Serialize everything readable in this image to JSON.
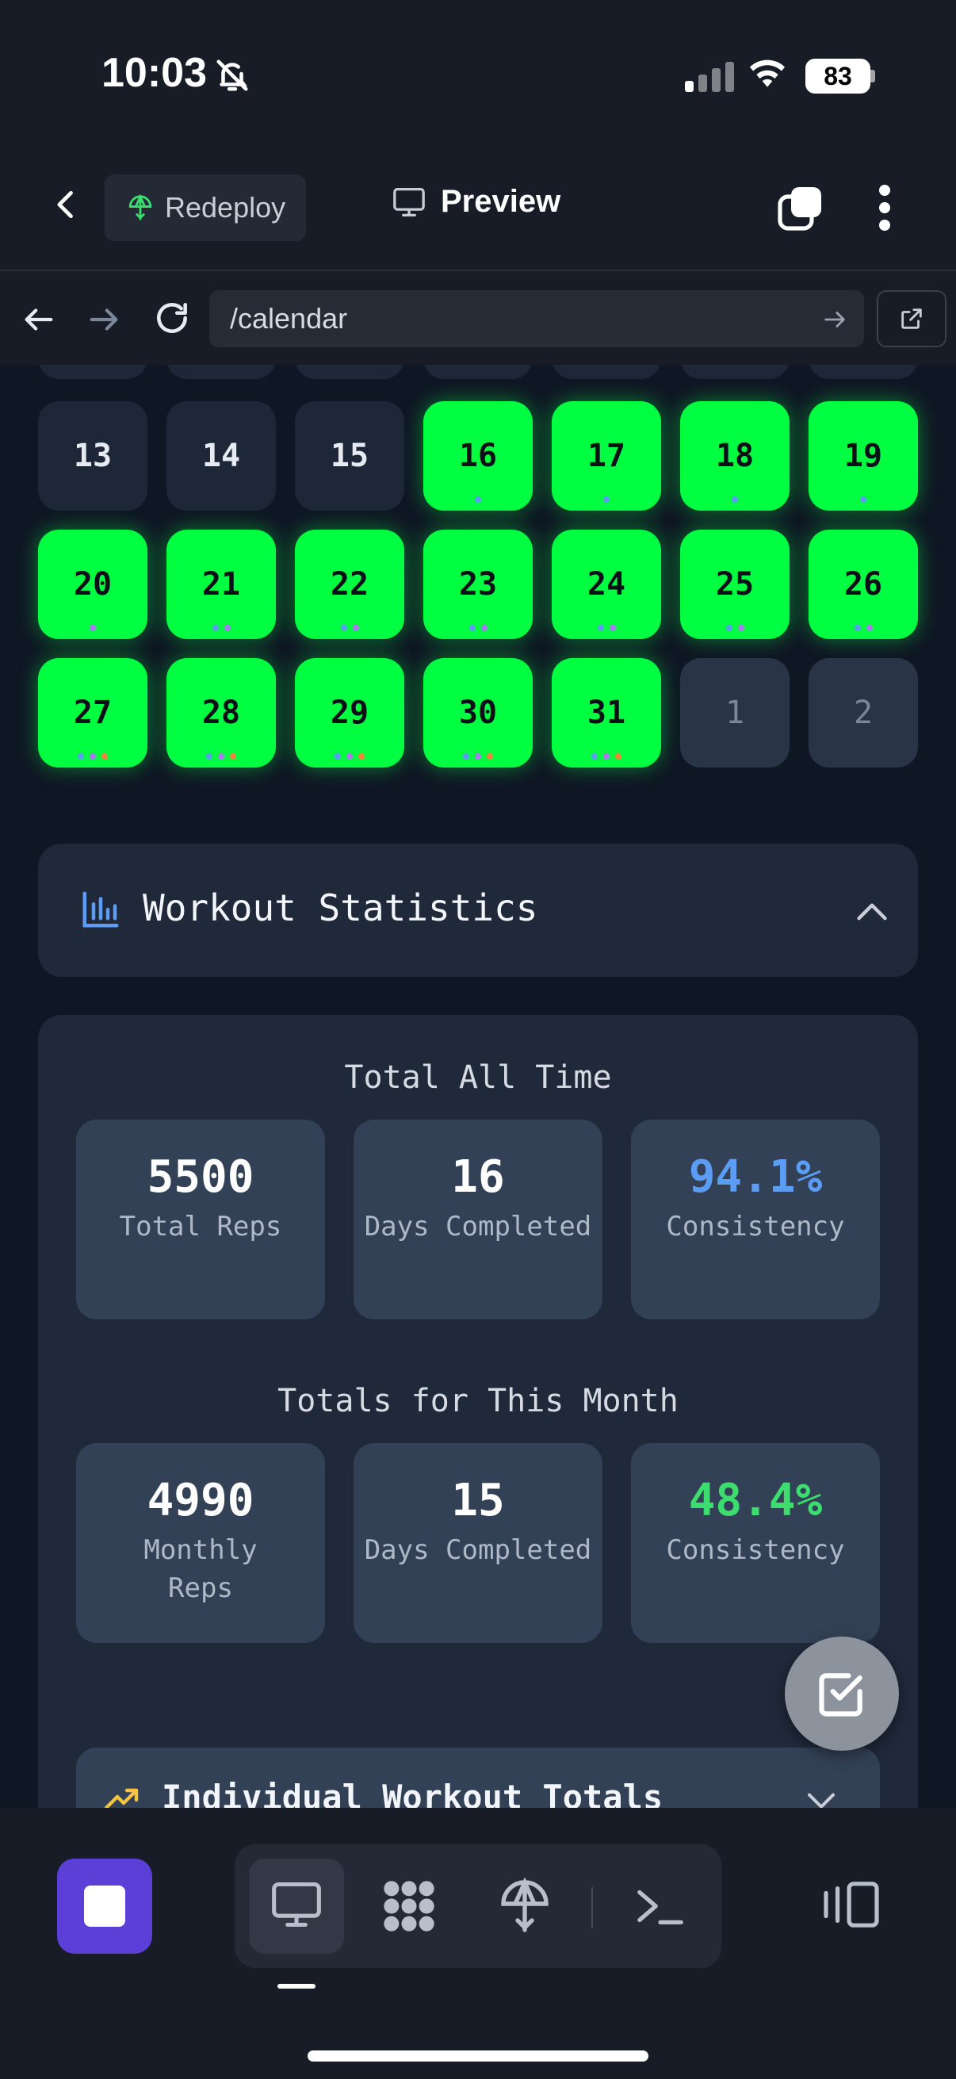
{
  "status_bar": {
    "time": "10:03",
    "battery": "83"
  },
  "header": {
    "redeploy_label": "Redeploy",
    "preview_label": "Preview"
  },
  "url_bar": {
    "path": "/calendar"
  },
  "calendar": {
    "rows": [
      [
        {
          "d": "13",
          "state": "plain"
        },
        {
          "d": "14",
          "state": "plain"
        },
        {
          "d": "15",
          "state": "plain"
        },
        {
          "d": "16",
          "state": "done",
          "dots": [
            "#5b9cf5"
          ]
        },
        {
          "d": "17",
          "state": "done",
          "dots": [
            "#5b9cf5"
          ]
        },
        {
          "d": "18",
          "state": "done",
          "dots": [
            "#5b9cf5"
          ]
        },
        {
          "d": "19",
          "state": "done",
          "dots": [
            "#5b9cf5"
          ]
        }
      ],
      [
        {
          "d": "20",
          "state": "done",
          "dots": [
            "#a77bf3"
          ]
        },
        {
          "d": "21",
          "state": "done",
          "dots": [
            "#5b9cf5",
            "#a77bf3"
          ]
        },
        {
          "d": "22",
          "state": "done",
          "dots": [
            "#5b9cf5",
            "#a77bf3"
          ]
        },
        {
          "d": "23",
          "state": "done",
          "dots": [
            "#5b9cf5",
            "#a77bf3"
          ]
        },
        {
          "d": "24",
          "state": "done",
          "dots": [
            "#5b9cf5",
            "#a77bf3"
          ]
        },
        {
          "d": "25",
          "state": "done",
          "dots": [
            "#5b9cf5",
            "#a77bf3"
          ]
        },
        {
          "d": "26",
          "state": "done",
          "dots": [
            "#5b9cf5",
            "#a77bf3"
          ]
        }
      ],
      [
        {
          "d": "27",
          "state": "done",
          "dots": [
            "#5b9cf5",
            "#a77bf3",
            "#f5843a"
          ]
        },
        {
          "d": "28",
          "state": "done",
          "dots": [
            "#5b9cf5",
            "#a77bf3",
            "#f5843a"
          ]
        },
        {
          "d": "29",
          "state": "done",
          "dots": [
            "#5b9cf5",
            "#a77bf3",
            "#f5843a"
          ]
        },
        {
          "d": "30",
          "state": "done",
          "dots": [
            "#5b9cf5",
            "#a77bf3",
            "#f5843a"
          ]
        },
        {
          "d": "31",
          "state": "done",
          "dots": [
            "#5b9cf5",
            "#a77bf3",
            "#f5843a"
          ]
        },
        {
          "d": "1",
          "state": "other"
        },
        {
          "d": "2",
          "state": "other"
        }
      ]
    ]
  },
  "stats_panel": {
    "title": "Workout Statistics"
  },
  "all_time": {
    "heading": "Total All Time",
    "cards": [
      {
        "value": "5500",
        "label": "Total Reps",
        "color": "#ffffff"
      },
      {
        "value": "16",
        "label": "Days Completed",
        "color": "#ffffff"
      },
      {
        "value": "94.1%",
        "label": "Consistency",
        "color": "#5b9cf5"
      }
    ]
  },
  "month": {
    "heading": "Totals for This Month",
    "cards": [
      {
        "value": "4990",
        "label": "Monthly Reps",
        "color": "#ffffff"
      },
      {
        "value": "15",
        "label": "Days Completed",
        "color": "#ffffff"
      },
      {
        "value": "48.4%",
        "label": "Consistency",
        "color": "#3ddc6f"
      }
    ]
  },
  "individual": {
    "title": "Individual Workout Totals"
  },
  "colors": {
    "done": "#00ff41",
    "accent": "#5b3fd6"
  }
}
